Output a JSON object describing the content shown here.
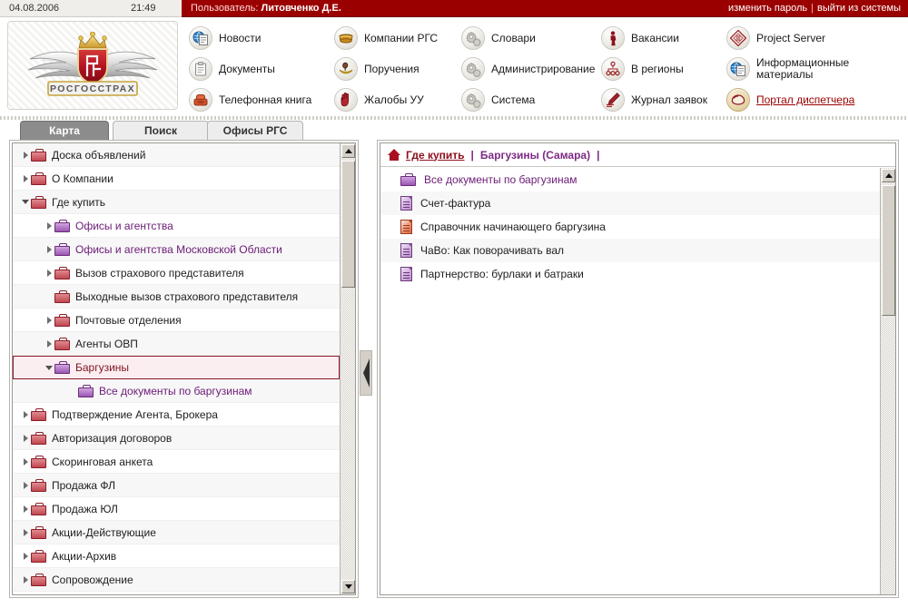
{
  "topbar": {
    "date": "04.08.2006",
    "time": "21:49",
    "user_prefix": "Пользователь:",
    "user_name": "Литовченко Д.Е.",
    "change_password": "изменить пароль",
    "separator": "|",
    "logout": "выйти из системы"
  },
  "logo": {
    "wordmark": "РОСГОССТРАХ",
    "alt": "Росгосстрах"
  },
  "menu": {
    "columns": [
      {
        "items": [
          {
            "label": "Новости",
            "icon": "news-globe-icon",
            "link": false
          },
          {
            "label": "Документы",
            "icon": "clipboard-icon",
            "link": false
          },
          {
            "label": "Телефонная книга",
            "icon": "telephone-icon",
            "link": false
          }
        ]
      },
      {
        "items": [
          {
            "label": "Компании РГС",
            "icon": "briefcase-gold-icon",
            "link": false
          },
          {
            "label": "Поручения",
            "icon": "banana-pin-icon",
            "link": false
          },
          {
            "label": "Жалобы УУ",
            "icon": "hand-stop-icon",
            "link": false
          }
        ]
      },
      {
        "items": [
          {
            "label": "Словари",
            "icon": "gears-icon",
            "link": false
          },
          {
            "label": "Администрирование",
            "icon": "gears-icon",
            "link": false
          },
          {
            "label": "Система",
            "icon": "gears-icon",
            "link": false
          }
        ]
      },
      {
        "items": [
          {
            "label": "Вакансии",
            "icon": "person-icon",
            "link": false
          },
          {
            "label": "В регионы",
            "icon": "hierarchy-icon",
            "link": false
          },
          {
            "label": "Журнал заявок",
            "icon": "pen-icon",
            "link": false
          }
        ]
      },
      {
        "items": [
          {
            "label": "Project Server",
            "icon": "diamond-stack-icon",
            "link": false
          },
          {
            "label": "Информационные материалы",
            "icon": "info-globe-icon",
            "link": false
          },
          {
            "label": "Портал диспетчера",
            "icon": "dispatcher-icon",
            "link": true
          }
        ]
      }
    ]
  },
  "tabs": [
    {
      "label": "Карта",
      "active": true
    },
    {
      "label": "Поиск",
      "active": false
    },
    {
      "label": "Офисы РГС",
      "active": false
    }
  ],
  "tree": {
    "items": [
      {
        "label": "Доска объявлений",
        "indent": 0,
        "state": "collapsed",
        "color": "default",
        "selected": false
      },
      {
        "label": "О Компании",
        "indent": 0,
        "state": "collapsed",
        "color": "default",
        "selected": false
      },
      {
        "label": "Где купить",
        "indent": 0,
        "state": "expanded",
        "color": "default",
        "selected": false
      },
      {
        "label": "Офисы и агентства",
        "indent": 1,
        "state": "collapsed",
        "color": "purple",
        "selected": false
      },
      {
        "label": "Офисы и агентства Московской Области",
        "indent": 1,
        "state": "collapsed",
        "color": "purple",
        "selected": false
      },
      {
        "label": "Вызов страхового представителя",
        "indent": 1,
        "state": "collapsed",
        "color": "default",
        "selected": false
      },
      {
        "label": "Выходные вызов страхового представителя",
        "indent": 1,
        "state": "leaf",
        "color": "default",
        "selected": false
      },
      {
        "label": "Почтовые отделения",
        "indent": 1,
        "state": "collapsed",
        "color": "default",
        "selected": false
      },
      {
        "label": "Агенты ОВП",
        "indent": 1,
        "state": "collapsed",
        "color": "default",
        "selected": false
      },
      {
        "label": "Баргузины",
        "indent": 1,
        "state": "expanded",
        "color": "purple",
        "selected": true
      },
      {
        "label": "Все документы по баргузинам",
        "indent": 2,
        "state": "leaf",
        "color": "purple",
        "selected": false
      },
      {
        "label": "Подтверждение Агента, Брокера",
        "indent": 0,
        "state": "collapsed",
        "color": "default",
        "selected": false
      },
      {
        "label": "Авторизация договоров",
        "indent": 0,
        "state": "collapsed",
        "color": "default",
        "selected": false
      },
      {
        "label": "Скоринговая анкета",
        "indent": 0,
        "state": "collapsed",
        "color": "default",
        "selected": false
      },
      {
        "label": "Продажа ФЛ",
        "indent": 0,
        "state": "collapsed",
        "color": "default",
        "selected": false
      },
      {
        "label": "Продажа ЮЛ",
        "indent": 0,
        "state": "collapsed",
        "color": "default",
        "selected": false
      },
      {
        "label": "Акции-Действующие",
        "indent": 0,
        "state": "collapsed",
        "color": "default",
        "selected": false
      },
      {
        "label": "Акции-Архив",
        "indent": 0,
        "state": "collapsed",
        "color": "default",
        "selected": false
      },
      {
        "label": "Сопровождение",
        "indent": 0,
        "state": "collapsed",
        "color": "default",
        "selected": false
      }
    ]
  },
  "breadcrumb": {
    "home_icon": "home-icon",
    "root": "Где купить",
    "divider": "|",
    "current": "Баргузины (Самара)",
    "trailing": "|"
  },
  "documents": {
    "items": [
      {
        "label": "Все документы по баргузинам",
        "icon": "folder-purple-icon",
        "color": "purple"
      },
      {
        "label": "Счет-фактура",
        "icon": "document-purple-icon",
        "color": "default"
      },
      {
        "label": "Справочник начинающего баргузина",
        "icon": "document-red-icon",
        "color": "default"
      },
      {
        "label": "ЧаВо: Как поворачивать вал",
        "icon": "document-purple-icon",
        "color": "default"
      },
      {
        "label": "Партнерство: бурлаки и батраки",
        "icon": "document-purple-icon",
        "color": "default"
      }
    ]
  },
  "colors": {
    "brand_red": "#9b0000",
    "accent_purple": "#6b1b76",
    "link_red": "#8e0f1c",
    "selected_row_bg": "#fbeef0",
    "selected_row_border": "#8f1a2a"
  }
}
